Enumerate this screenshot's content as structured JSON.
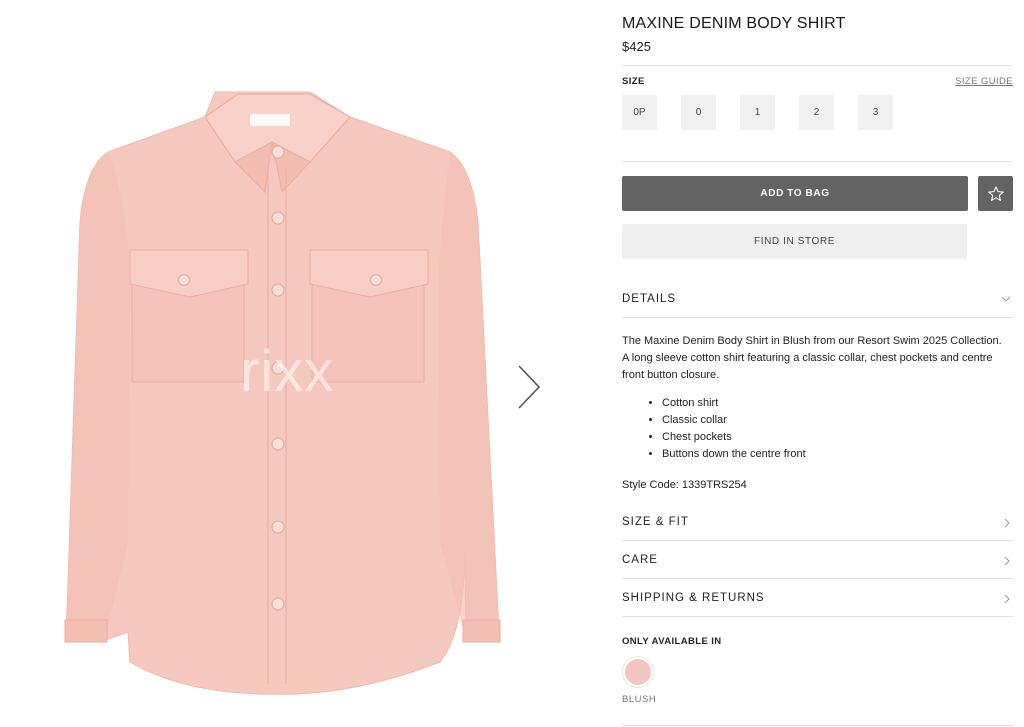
{
  "gallery": {
    "watermark": "rixx",
    "next_icon": "chevron-right-icon"
  },
  "product": {
    "title": "MAXINE DENIM BODY SHIRT",
    "price": "$425",
    "size_label": "SIZE",
    "size_guide": "SIZE GUIDE",
    "sizes": [
      "0P",
      "0",
      "1",
      "2",
      "3"
    ],
    "add_to_bag": "ADD TO BAG",
    "wishlist_icon": "star-icon",
    "find_in_store": "FIND IN STORE"
  },
  "details": {
    "label": "DETAILS",
    "description": "The Maxine Denim Body Shirt in Blush from our Resort Swim 2025 Collection. A long sleeve cotton shirt featuring a classic collar, chest pockets and centre front button closure.",
    "bullets": [
      "Cotton shirt",
      "Classic collar",
      "Chest pockets",
      "Buttons down the centre front"
    ],
    "style_code": "Style Code: 1339TRS254"
  },
  "accordions": {
    "size_fit": "SIZE & FIT",
    "care": "CARE",
    "shipping": "SHIPPING & RETURNS"
  },
  "availability": {
    "label": "ONLY AVAILABLE IN",
    "color_name": "BLUSH",
    "color_hex": "#f5c6c0"
  },
  "colors": {
    "shirt": "#f6c9be",
    "button_dark": "#636363",
    "button_light": "#efefef"
  }
}
